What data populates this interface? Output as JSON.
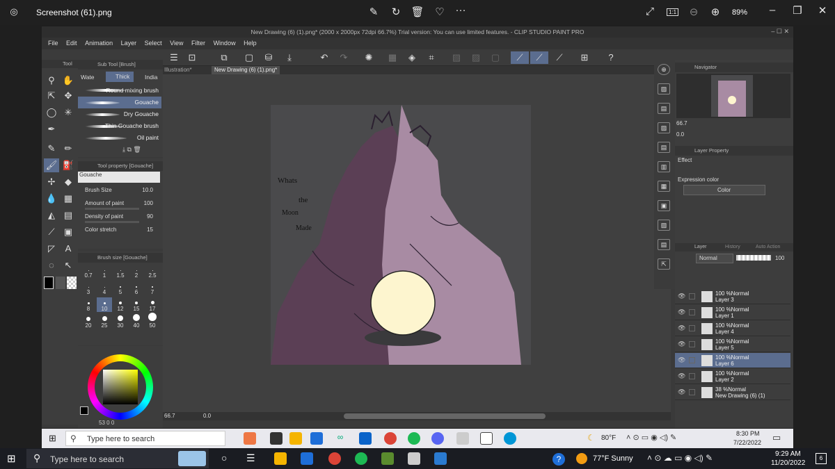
{
  "viewer": {
    "filename": "Screenshot (61).png",
    "zoom": "89%",
    "actual_size_label": "1:1"
  },
  "csp": {
    "window_title": "New Drawing (6) (1).png* (2000 x 2000px 72dpi 66.7%)  Trial version: You can use limited features. - CLIP STUDIO PAINT PRO",
    "menu": [
      "File",
      "Edit",
      "Animation",
      "Layer",
      "Select",
      "View",
      "Filter",
      "Window",
      "Help"
    ],
    "tabs": [
      "Illustration*",
      "New Drawing (6) (1).png*"
    ],
    "tool_label": "Tool",
    "subtool_header": "Sub Tool [Brush]",
    "subtool_tabs": [
      "Wate",
      "Thick",
      "India"
    ],
    "brushes": [
      "Round mixing brush",
      "Gouache",
      "Dry Gouache",
      "Thin Gouache brush",
      "Oil paint"
    ],
    "tool_property_header": "Tool property [Gouache]",
    "tool_property_name": "Gouache",
    "props": [
      {
        "label": "Brush Size",
        "value": "10.0"
      },
      {
        "label": "Amount of paint",
        "value": "100"
      },
      {
        "label": "Density of paint",
        "value": "90"
      },
      {
        "label": "Color stretch",
        "value": "15"
      }
    ],
    "brush_size_header": "Brush size [Gouache]",
    "brush_sizes": [
      "0.7",
      "1",
      "1.5",
      "2",
      "2.5",
      "3",
      "4",
      "5",
      "6",
      "7",
      "8",
      "10",
      "12",
      "15",
      "17",
      "20",
      "25",
      "30",
      "40",
      "50"
    ],
    "selected_brush_size": "10",
    "canvas_zoom": "66.7",
    "canvas_angle": "0.0",
    "canvas_text": [
      "Whats",
      "the",
      "Moon",
      "Made"
    ],
    "color_footer": "53",
    "color_footer2": "0",
    "color_footer3": "0",
    "navigator_header": "Navigator",
    "nav_zoom": "66.7",
    "nav_angle": "0.0",
    "layer_property_header": "Layer Property",
    "effect_label": "Effect",
    "expression_color_label": "Expression color",
    "expression_color_value": "Color",
    "layer_tabs": [
      "Layer",
      "History",
      "Auto Action"
    ],
    "blend_mode": "Normal",
    "opacity": "100",
    "layers": [
      {
        "opacity": "100 %Normal",
        "name": "Layer 3",
        "selected": false
      },
      {
        "opacity": "100 %Normal",
        "name": "Layer 1",
        "selected": false
      },
      {
        "opacity": "100 %Normal",
        "name": "Layer 4",
        "selected": false
      },
      {
        "opacity": "100 %Normal",
        "name": "Layer 5",
        "selected": false
      },
      {
        "opacity": "100 %Normal",
        "name": "Layer 6",
        "selected": true
      },
      {
        "opacity": "100 %Normal",
        "name": "Layer 2",
        "selected": false
      },
      {
        "opacity": "38 %Normal",
        "name": "New Drawing (6) (1)",
        "selected": false
      }
    ]
  },
  "inner_taskbar": {
    "search_placeholder": "Type here to search",
    "temp": "80°F",
    "time": "8:30 PM",
    "date": "7/22/2022"
  },
  "outer_taskbar": {
    "search_placeholder": "Type here to search",
    "weather": "77°F  Sunny",
    "time": "9:29 AM",
    "date": "11/20/2022",
    "notifications": "6"
  },
  "colors": {
    "accent": "#5b6d8f",
    "canvas_bg": "#4a4a4c",
    "dark_figure": "#5b3f55",
    "light_figure": "#a88ba3",
    "moon": "#fdf5cf"
  }
}
